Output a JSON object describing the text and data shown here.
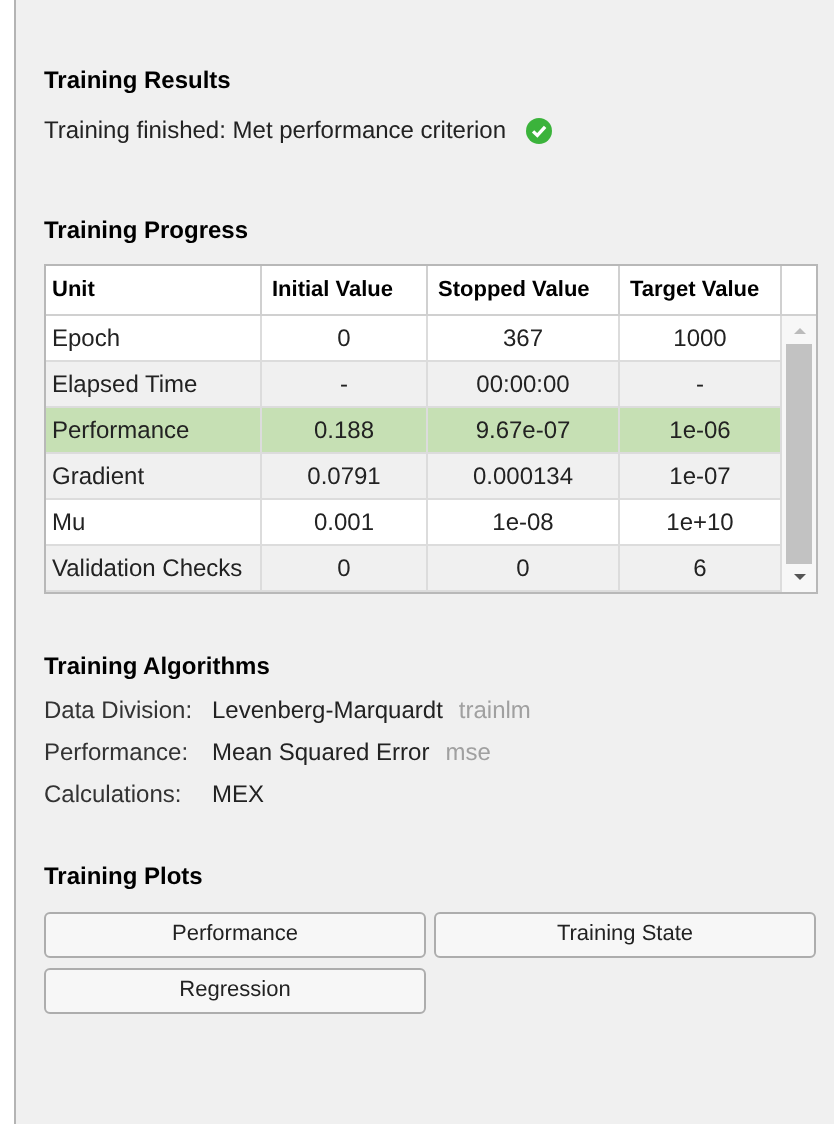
{
  "results": {
    "title": "Training Results",
    "message": "Training finished: Met performance criterion",
    "met": true
  },
  "progress": {
    "title": "Training Progress",
    "columns": [
      "Unit",
      "Initial Value",
      "Stopped Value",
      "Target Value"
    ],
    "rows": [
      {
        "cells": [
          "Epoch",
          "0",
          "367",
          "1000"
        ],
        "selected": false
      },
      {
        "cells": [
          "Elapsed Time",
          "-",
          "00:00:00",
          "-"
        ],
        "selected": false
      },
      {
        "cells": [
          "Performance",
          "0.188",
          "9.67e-07",
          "1e-06"
        ],
        "selected": true
      },
      {
        "cells": [
          "Gradient",
          "0.0791",
          "0.000134",
          "1e-07"
        ],
        "selected": false
      },
      {
        "cells": [
          "Mu",
          "0.001",
          "1e-08",
          "1e+10"
        ],
        "selected": false
      },
      {
        "cells": [
          "Validation Checks",
          "0",
          "0",
          "6"
        ],
        "selected": false
      }
    ]
  },
  "algorithms": {
    "title": "Training Algorithms",
    "items": [
      {
        "label": "Data Division:",
        "value": "Levenberg-Marquardt",
        "code": "trainlm"
      },
      {
        "label": "Performance:",
        "value": "Mean Squared Error",
        "code": "mse"
      },
      {
        "label": "Calculations:",
        "value": "MEX"
      }
    ]
  },
  "plots": {
    "title": "Training Plots",
    "buttons": [
      "Performance",
      "Training State",
      "Regression"
    ]
  }
}
